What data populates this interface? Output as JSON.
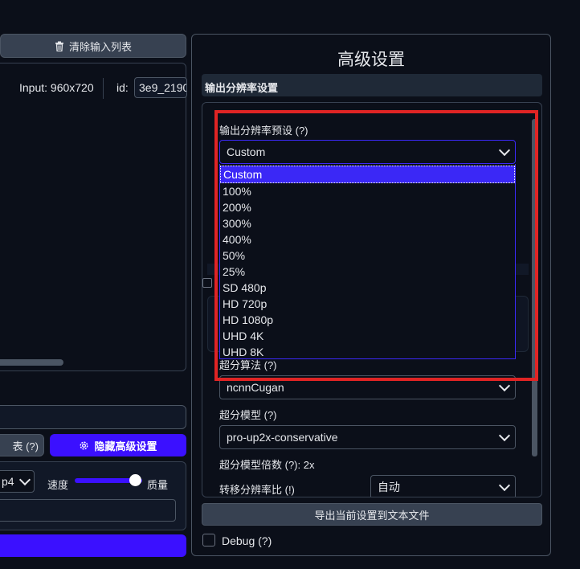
{
  "left": {
    "clear_button": "清除输入列表",
    "input_info": "Input: 960x720",
    "id_label": "id:",
    "id_value": "3e9_2190",
    "help_button": "表 (?)",
    "hide_advanced": "隐藏高级设置",
    "format_value": "p4",
    "speed_label": "速度",
    "quality_label": "质量",
    "slider_value": 0.95
  },
  "right": {
    "title": "高级设置",
    "section_header": "输出分辨率设置",
    "preset_label": "输出分辨率预设 (?)",
    "preset_value": "Custom",
    "preset_options": [
      "Custom",
      "100%",
      "200%",
      "300%",
      "400%",
      "50%",
      "25%",
      "SD 480p",
      "HD 720p",
      "HD 1080p",
      "UHD 4K",
      "UHD 8K"
    ],
    "algo_label": "超分算法 (?)",
    "algo_value": "ncnnCugan",
    "model_label": "超分模型 (?)",
    "model_value": "pro-up2x-conservative",
    "scale_label": "超分模型倍数 (?): 2x",
    "ratio_label": "转移分辨率比 (!)",
    "ratio_value": "自动",
    "export_button": "导出当前设置到文本文件",
    "debug_label": "Debug (?)"
  },
  "colors": {
    "accent": "#3b10ff",
    "highlight_box": "#e02424",
    "background": "#0b0f19"
  }
}
